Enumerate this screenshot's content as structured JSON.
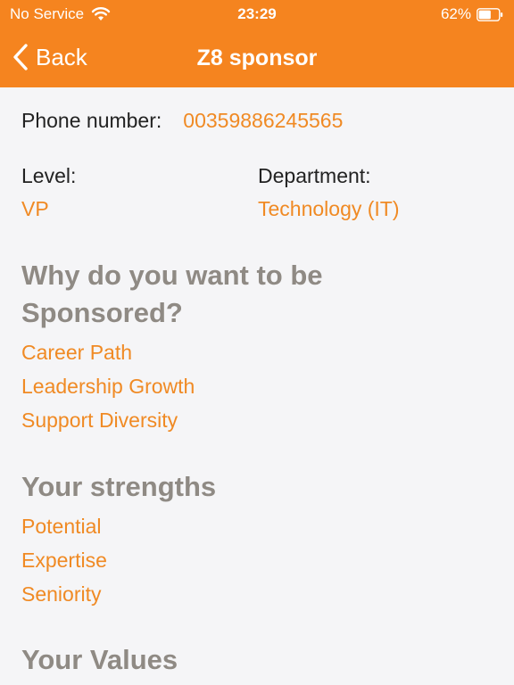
{
  "status_bar": {
    "carrier": "No Service",
    "time": "23:29",
    "battery": "62%",
    "battery_level": 0.62
  },
  "nav": {
    "back_label": "Back",
    "title": "Z8 sponsor"
  },
  "profile": {
    "phone_label": "Phone number:",
    "phone_value": "00359886245565",
    "level_label": "Level:",
    "level_value": "VP",
    "department_label": "Department:",
    "department_value": "Technology (IT)"
  },
  "sections": {
    "why": {
      "title": "Why do you want to be Sponsored?",
      "items": [
        "Career Path",
        "Leadership Growth",
        "Support Diversity"
      ]
    },
    "strengths": {
      "title": "Your strengths",
      "items": [
        "Potential",
        "Expertise",
        "Seniority"
      ]
    },
    "values": {
      "title": "Your Values"
    }
  },
  "colors": {
    "accent": "#f5841f",
    "text_orange": "#f08a24",
    "heading": "#8f8a84",
    "background": "#f5f5f7"
  }
}
